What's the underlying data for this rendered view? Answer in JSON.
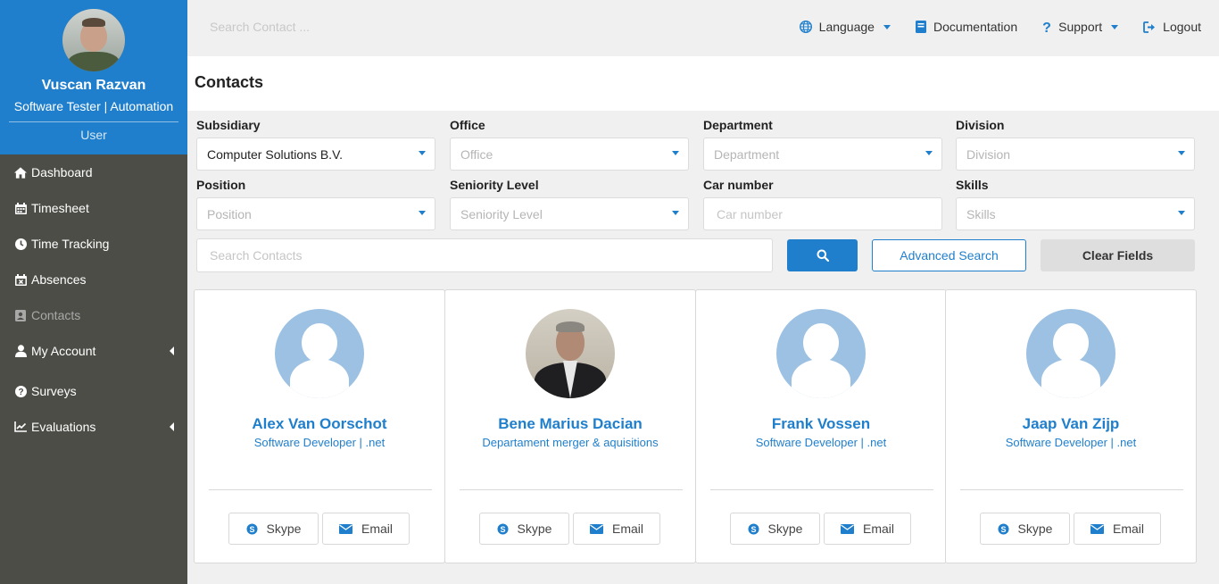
{
  "user": {
    "name": "Vuscan Razvan",
    "role": "Software Tester | Automation",
    "type": "User"
  },
  "sidebar": {
    "items": [
      {
        "label": "Dashboard",
        "icon": "home-icon"
      },
      {
        "label": "Timesheet",
        "icon": "calendar-icon"
      },
      {
        "label": "Time Tracking",
        "icon": "clock-icon"
      },
      {
        "label": "Absences",
        "icon": "calendar-x-icon"
      },
      {
        "label": "Contacts",
        "icon": "contact-card-icon",
        "active": true
      },
      {
        "label": "My Account",
        "icon": "user-icon",
        "submenu": true
      },
      {
        "label": "Surveys",
        "icon": "question-circle-icon"
      },
      {
        "label": "Evaluations",
        "icon": "line-chart-icon",
        "submenu": true
      }
    ]
  },
  "topbar": {
    "search_placeholder": "Search Contact ...",
    "language": "Language",
    "documentation": "Documentation",
    "support": "Support",
    "logout": "Logout"
  },
  "page": {
    "title": "Contacts"
  },
  "filters": {
    "subsidiary": {
      "label": "Subsidiary",
      "value": "Computer Solutions B.V."
    },
    "office": {
      "label": "Office",
      "placeholder": "Office"
    },
    "department": {
      "label": "Department",
      "placeholder": "Department"
    },
    "division": {
      "label": "Division",
      "placeholder": "Division"
    },
    "position": {
      "label": "Position",
      "placeholder": "Position"
    },
    "seniority": {
      "label": "Seniority Level",
      "placeholder": "Seniority Level"
    },
    "car_number": {
      "label": "Car number",
      "placeholder": "Car number"
    },
    "skills": {
      "label": "Skills",
      "placeholder": "Skills"
    }
  },
  "search": {
    "placeholder": "Search Contacts",
    "advanced_label": "Advanced Search",
    "clear_label": "Clear Fields"
  },
  "contacts": [
    {
      "name": "Alex Van Oorschot",
      "title": "Software Developer | .net",
      "skype": "Skype",
      "email": "Email",
      "photo": false
    },
    {
      "name": "Bene Marius Dacian",
      "title": "Departament merger & aquisitions",
      "skype": "Skype",
      "email": "Email",
      "photo": true
    },
    {
      "name": "Frank Vossen",
      "title": "Software Developer | .net",
      "skype": "Skype",
      "email": "Email",
      "photo": false
    },
    {
      "name": "Jaap Van Zijp",
      "title": "Software Developer | .net",
      "skype": "Skype",
      "email": "Email",
      "photo": false
    }
  ],
  "colors": {
    "primary": "#1f7fcc",
    "sidebar_bg": "#4d4d48",
    "avatar_placeholder": "#9cc1e3"
  }
}
